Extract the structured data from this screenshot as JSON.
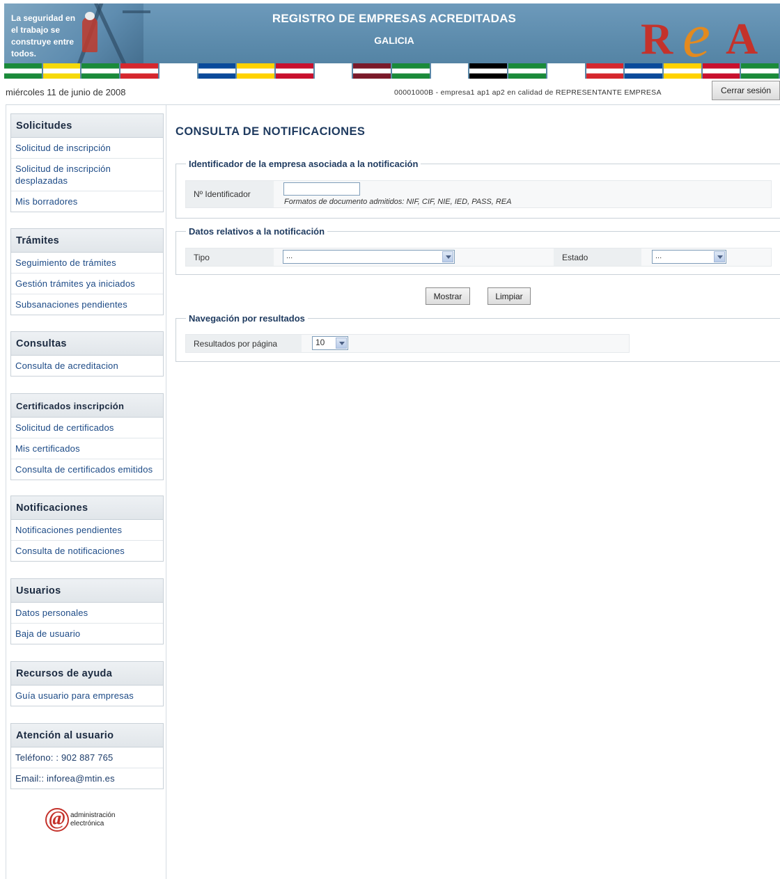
{
  "banner": {
    "slogan": "La seguridad en el trabajo se construye entre todos.",
    "title": "REGISTRO DE EMPRESAS ACREDITADAS",
    "subtitle": "GALICIA",
    "logo_text": "REA",
    "flag_colors": [
      "#1a8a3a",
      "#f5d90a",
      "#1a8a3a",
      "#d5272e",
      "#ffffff",
      "#0a4a9a",
      "#ffd200",
      "#c8102e",
      "#fff",
      "#7a1a2a",
      "#1a8a3a",
      "#ffffff",
      "#000000",
      "#1a8a3a",
      "#fff",
      "#d5272e",
      "#0a4a9a",
      "#ffd200",
      "#c8102e",
      "#1a8a3a"
    ]
  },
  "status": {
    "date": "miércoles 11 de junio de 2008",
    "user_info": "00001000B - empresa1 ap1 ap2 en calidad de REPRESENTANTE EMPRESA",
    "logout_label": "Cerrar sesión"
  },
  "sidebar": {
    "solicitudes": {
      "title": "Solicitudes",
      "items": [
        "Solicitud de inscripción",
        "Solicitud de inscripción desplazadas",
        "Mis borradores"
      ]
    },
    "tramites": {
      "title": "Trámites",
      "items": [
        "Seguimiento de trámites",
        "Gestión trámites ya iniciados",
        "Subsanaciones pendientes"
      ]
    },
    "consultas": {
      "title": "Consultas",
      "items": [
        "Consulta de acreditacion"
      ]
    },
    "certificados": {
      "title": "Certificados inscripción",
      "items": [
        "Solicitud de certificados",
        "Mis certificados",
        "Consulta de certificados emitidos"
      ]
    },
    "notificaciones": {
      "title": "Notificaciones",
      "items": [
        "Notificaciones pendientes",
        "Consulta de notificaciones"
      ]
    },
    "usuarios": {
      "title": "Usuarios",
      "items": [
        "Datos personales",
        "Baja de usuario"
      ]
    },
    "ayuda": {
      "title": "Recursos de ayuda",
      "items": [
        "Guía usuario para empresas"
      ]
    },
    "atencion": {
      "title": "Atención al usuario",
      "items": [
        "Teléfono: : 902 887 765",
        "Email:: inforea@mtin.es"
      ]
    },
    "ae_logo": {
      "line1": "administración",
      "line2": "electrónica"
    }
  },
  "main": {
    "page_title": "CONSULTA DE NOTIFICACIONES",
    "identificador": {
      "legend": "Identificador de la empresa asociada a la notificación",
      "label": "Nº Identificador",
      "value": "",
      "hint": "Formatos de documento admitidos: NIF, CIF, NIE, IED, PASS, REA"
    },
    "datos": {
      "legend": "Datos relativos a la notificación",
      "tipo_label": "Tipo",
      "tipo_value": "...",
      "estado_label": "Estado",
      "estado_value": "..."
    },
    "buttons": {
      "mostrar": "Mostrar",
      "limpiar": "Limpiar"
    },
    "navegacion": {
      "legend": "Navegación por resultados",
      "label": "Resultados por página",
      "value": "10"
    }
  }
}
